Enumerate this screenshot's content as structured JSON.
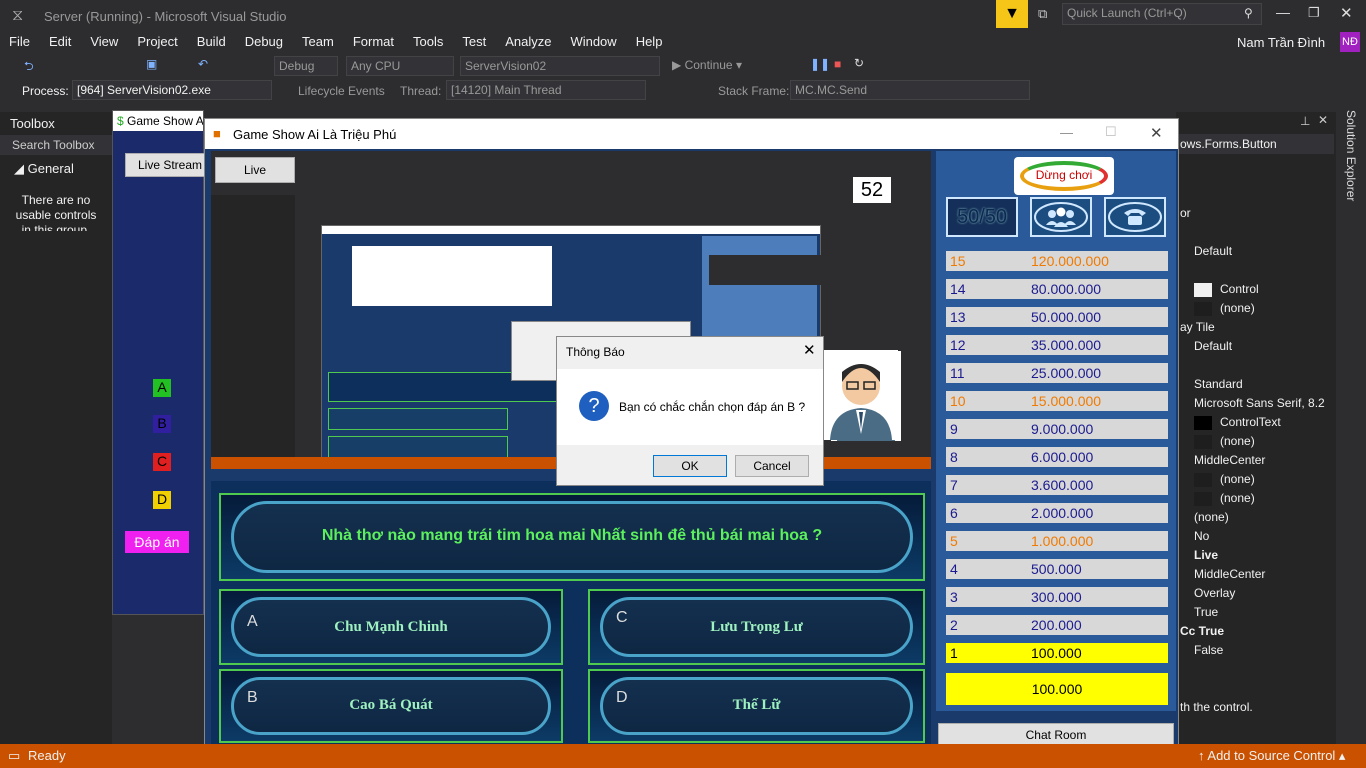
{
  "vs": {
    "title": "Server (Running) - Microsoft Visual Studio",
    "quick_launch": "Quick Launch (Ctrl+Q)",
    "user": "Nam Trần Đình",
    "user_initials": "NĐ",
    "menu": [
      "File",
      "Edit",
      "View",
      "Project",
      "Build",
      "Debug",
      "Team",
      "Format",
      "Tools",
      "Test",
      "Analyze",
      "Window",
      "Help"
    ],
    "toolbar": {
      "config": "Debug",
      "platform": "Any CPU",
      "project": "ServerVision02",
      "continue": "Continue"
    },
    "debugbar": {
      "process_label": "Process:",
      "process": "[964] ServerVision02.exe",
      "lifecycle": "Lifecycle Events",
      "thread_label": "Thread:",
      "thread": "[14120] Main Thread",
      "stack_label": "Stack Frame:",
      "stack": "MC.MC.Send"
    },
    "toolbox": {
      "title": "Toolbox",
      "search": "Search Toolbox",
      "group": "General",
      "empty_text": "There are no usable controls in this group. Drag an item onto this text to add it to the toolbox."
    },
    "properties": {
      "header": "ows.Forms.Button",
      "rows": [
        "or",
        "Default",
        "Control",
        "(none)",
        "ay  Tile",
        "Default",
        "Standard",
        "Microsoft Sans Serif, 8.2",
        "ControlText",
        "(none)",
        "MiddleCenter",
        "(none)",
        "(none)",
        "(none)",
        "No",
        "Live",
        "MiddleCenter",
        "Overlay",
        "True",
        "Cc  True",
        "False"
      ],
      "help": "th the control."
    },
    "solution_explorer": "Solution Explorer",
    "status": {
      "ready": "Ready",
      "source_control": "Add to Source Control"
    }
  },
  "bgapp": {
    "title": "Game Show Ai Là Triệu phú",
    "live_stream": "Live Stream",
    "letters": [
      "A",
      "B",
      "C",
      "D"
    ],
    "answer_label": "Đáp án"
  },
  "game": {
    "title": "Game Show Ai Là Triệu Phú",
    "live_button": "Live",
    "counter": "52",
    "question": "Nhà thơ nào mang trái tim hoa mai Nhất sinh đê thủ bái mai hoa ?",
    "answers": [
      {
        "letter": "A",
        "text": "Chu Mạnh Chinh"
      },
      {
        "letter": "C",
        "text": "Lưu Trọng Lư"
      },
      {
        "letter": "B",
        "text": "Cao Bá Quát"
      },
      {
        "letter": "D",
        "text": "Thế Lữ"
      }
    ],
    "stop_button": "Dừng chơi",
    "fifty": "50/50",
    "ladder": [
      {
        "n": "15",
        "v": "120.000.000"
      },
      {
        "n": "14",
        "v": "80.000.000"
      },
      {
        "n": "13",
        "v": "50.000.000"
      },
      {
        "n": "12",
        "v": "35.000.000"
      },
      {
        "n": "11",
        "v": "25.000.000"
      },
      {
        "n": "10",
        "v": "15.000.000"
      },
      {
        "n": "9",
        "v": "9.000.000"
      },
      {
        "n": "8",
        "v": "6.000.000"
      },
      {
        "n": "7",
        "v": "3.600.000"
      },
      {
        "n": "6",
        "v": "2.000.000"
      },
      {
        "n": "5",
        "v": "1.000.000"
      },
      {
        "n": "4",
        "v": "500.000"
      },
      {
        "n": "3",
        "v": "300.000"
      },
      {
        "n": "2",
        "v": "200.000"
      },
      {
        "n": "1",
        "v": "100.000"
      }
    ],
    "current_prize": "100.000",
    "chat_room": "Chat Room"
  },
  "dialog": {
    "title": "Thông Báo",
    "message": "Bạn có chắc chắn chọn đáp án B ?",
    "ok": "OK",
    "cancel": "Cancel"
  },
  "colors": {
    "vs_bg": "#2d2d30",
    "status": "#ca5100",
    "milestone": "#f07a00",
    "current": "#ffff00",
    "green_border": "#4fc94f"
  }
}
